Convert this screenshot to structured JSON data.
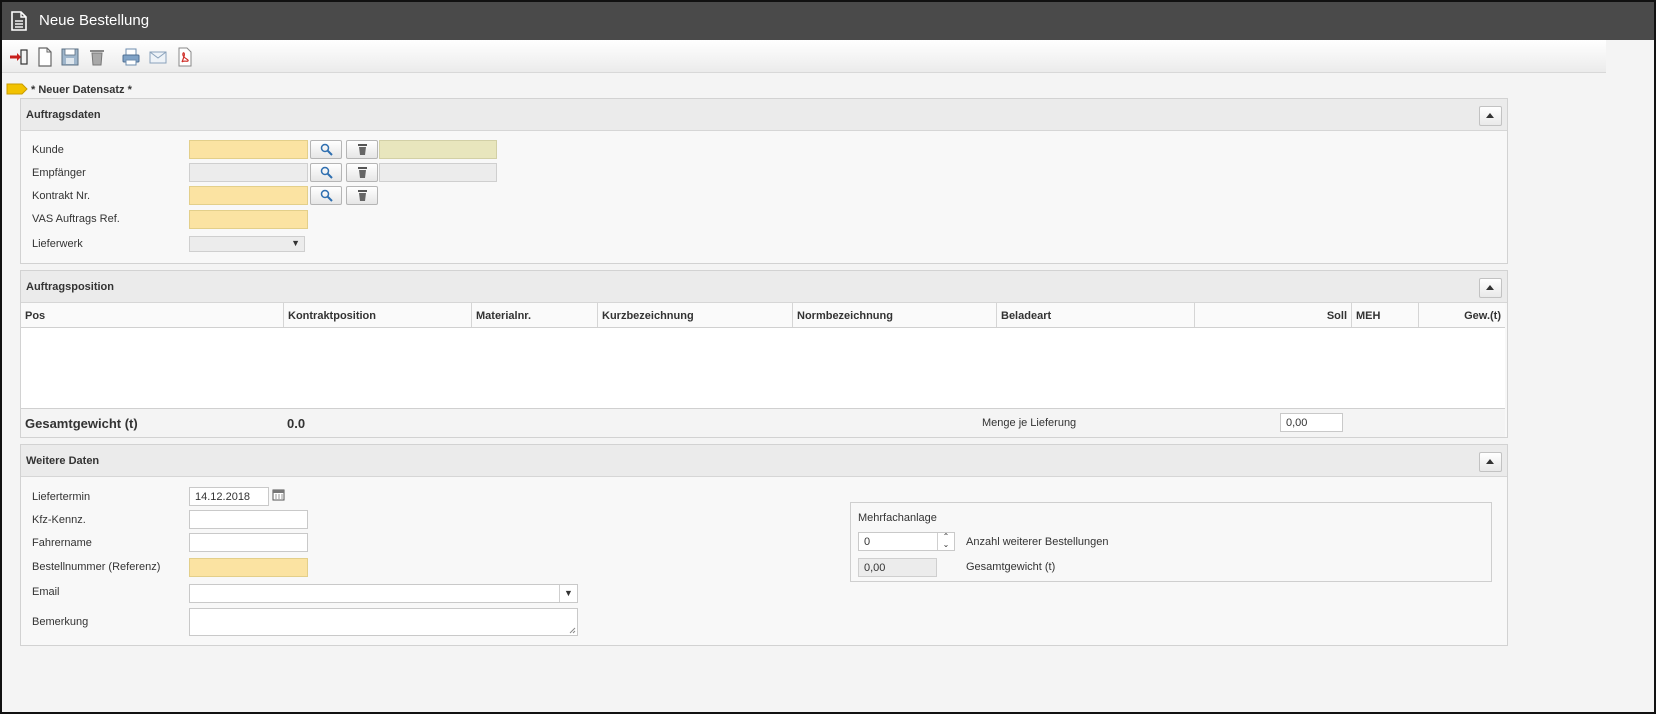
{
  "window": {
    "title": "Neue Bestellung"
  },
  "toolbar": {
    "buttons": [
      {
        "name": "exit-icon"
      },
      {
        "name": "new-document-icon"
      },
      {
        "name": "save-icon"
      },
      {
        "name": "delete-icon"
      },
      {
        "name": "print-icon"
      },
      {
        "name": "email-icon"
      },
      {
        "name": "pdf-icon"
      }
    ]
  },
  "record": {
    "label": "* Neuer Datensatz *"
  },
  "auftragsdaten": {
    "title": "Auftragsdaten",
    "kunde_label": "Kunde",
    "empfaenger_label": "Empfänger",
    "kontrakt_label": "Kontrakt Nr.",
    "vas_label": "VAS Auftrags Ref.",
    "lieferwerk_label": "Lieferwerk",
    "lieferwerk_value": ""
  },
  "auftragsposition": {
    "title": "Auftragsposition",
    "columns": [
      "Pos",
      "Kontraktposition",
      "Materialnr.",
      "Kurzbezeichnung",
      "Normbezeichnung",
      "Beladeart",
      "Soll",
      "MEH",
      "Gew.(t)"
    ],
    "rows": [],
    "total_label": "Gesamtgewicht (t)",
    "total_value": "0.0",
    "menge_label": "Menge je Lieferung",
    "menge_value": "0,00"
  },
  "weitere": {
    "title": "Weitere Daten",
    "liefertermin_label": "Liefertermin",
    "liefertermin_value": "14.12.2018",
    "kfz_label": "Kfz-Kennz.",
    "fahrer_label": "Fahrername",
    "bestellnr_label": "Bestellnummer (Referenz)",
    "email_label": "Email",
    "bemerkung_label": "Bemerkung",
    "mehrfach": {
      "title": "Mehrfachanlage",
      "anzahl_value": "0",
      "anzahl_label": "Anzahl weiterer Bestellungen",
      "gewicht_value": "0,00",
      "gewicht_label": "Gesamtgewicht (t)"
    }
  },
  "colors": {
    "titlebar": "#4a4a4a",
    "required": "#fbe3a2",
    "accent": "#f2c200"
  }
}
